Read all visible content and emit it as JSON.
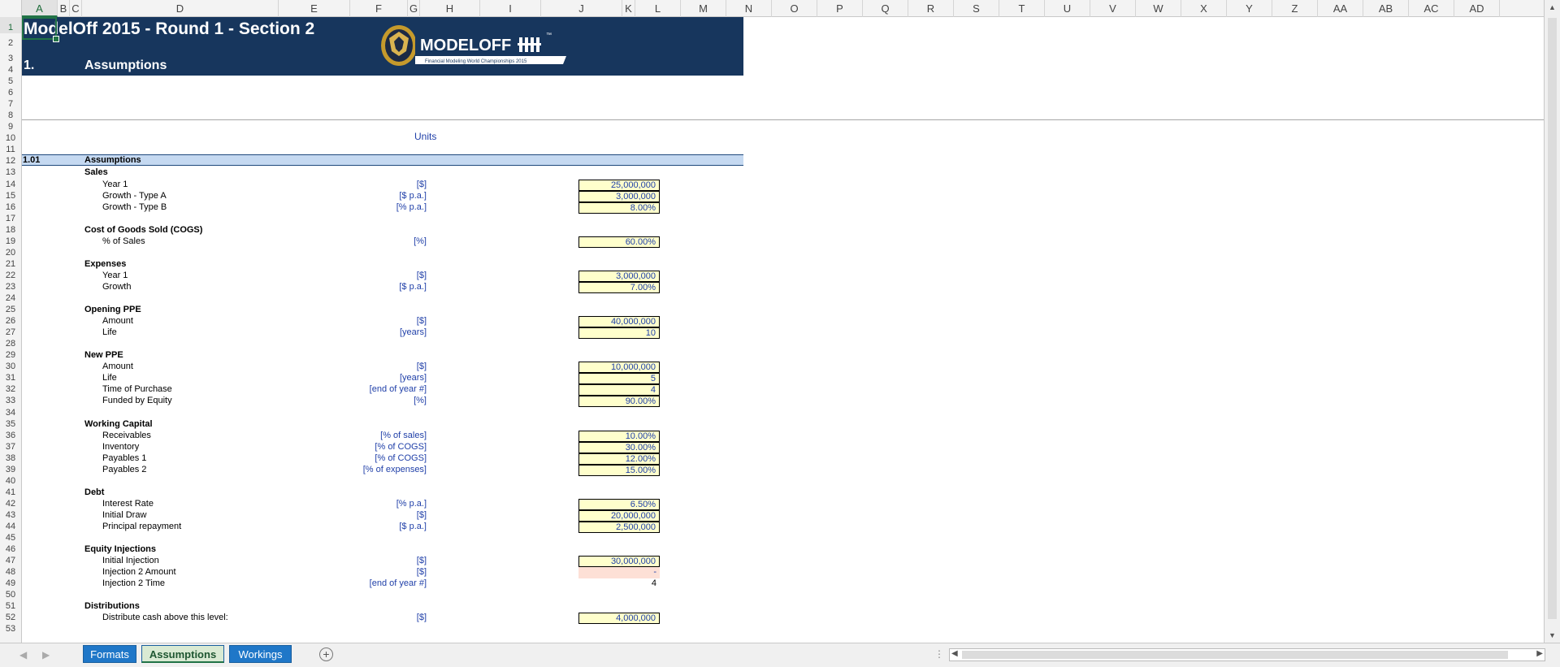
{
  "sheet": {
    "title": "ModelOff 2015 - Round 1 - Section 2",
    "section_number": "1.",
    "section_title": "Assumptions",
    "logo_text": "MODELOFF",
    "logo_tagline": "Financial Modeling World Championships 2015",
    "logo_tm": "™",
    "units_header": "Units",
    "subsection": {
      "number": "1.01",
      "title": "Assumptions"
    }
  },
  "columns": [
    "A",
    "B",
    "C",
    "D",
    "E",
    "F",
    "G",
    "H",
    "I",
    "J",
    "K",
    "L",
    "M",
    "N",
    "O",
    "P",
    "Q",
    "R",
    "S",
    "T",
    "U",
    "V",
    "W",
    "X",
    "Y",
    "Z",
    "AA",
    "AB",
    "AC",
    "AD"
  ],
  "rows": [
    "1",
    "2",
    "3",
    "4",
    "5",
    "6",
    "7",
    "8",
    "9",
    "10",
    "11",
    "12",
    "13",
    "14",
    "15",
    "16",
    "17",
    "18",
    "19",
    "20",
    "21",
    "22",
    "23",
    "24",
    "25",
    "26",
    "27",
    "28",
    "29",
    "30",
    "31",
    "32",
    "33",
    "34",
    "35",
    "36",
    "37",
    "38",
    "39",
    "40",
    "41",
    "42",
    "43",
    "44",
    "45",
    "46",
    "47",
    "48",
    "49",
    "50",
    "51",
    "52",
    "53"
  ],
  "groups": [
    {
      "row": 13,
      "label": "Sales"
    },
    {
      "row": 18,
      "label": "Cost of Goods Sold (COGS)"
    },
    {
      "row": 21,
      "label": "Expenses"
    },
    {
      "row": 25,
      "label": "Opening PPE"
    },
    {
      "row": 29,
      "label": "New PPE"
    },
    {
      "row": 35,
      "label": "Working Capital"
    },
    {
      "row": 41,
      "label": "Debt"
    },
    {
      "row": 46,
      "label": "Equity Injections"
    },
    {
      "row": 51,
      "label": "Distributions"
    }
  ],
  "items": [
    {
      "row": 14,
      "label": "Year 1",
      "unit": "[$]",
      "value": "25,000,000",
      "style": "input"
    },
    {
      "row": 15,
      "label": "Growth - Type A",
      "unit": "[$ p.a.]",
      "value": "3,000,000",
      "style": "input"
    },
    {
      "row": 16,
      "label": "Growth - Type B",
      "unit": "[% p.a.]",
      "value": "8.00%",
      "style": "input"
    },
    {
      "row": 19,
      "label": "% of Sales",
      "unit": "[%]",
      "value": "60.00%",
      "style": "input"
    },
    {
      "row": 22,
      "label": "Year 1",
      "unit": "[$]",
      "value": "3,000,000",
      "style": "input"
    },
    {
      "row": 23,
      "label": "Growth",
      "unit": "[$ p.a.]",
      "value": "7.00%",
      "style": "input"
    },
    {
      "row": 26,
      "label": "Amount",
      "unit": "[$]",
      "value": "40,000,000",
      "style": "input"
    },
    {
      "row": 27,
      "label": "Life",
      "unit": "[years]",
      "value": "10",
      "style": "input"
    },
    {
      "row": 30,
      "label": "Amount",
      "unit": "[$]",
      "value": "10,000,000",
      "style": "input"
    },
    {
      "row": 31,
      "label": "Life",
      "unit": "[years]",
      "value": "5",
      "style": "input"
    },
    {
      "row": 32,
      "label": "Time of Purchase",
      "unit": "[end of year #]",
      "value": "4",
      "style": "input"
    },
    {
      "row": 33,
      "label": "Funded by Equity",
      "unit": "[%]",
      "value": "90.00%",
      "style": "input"
    },
    {
      "row": 36,
      "label": "Receivables",
      "unit": "[% of sales]",
      "value": "10.00%",
      "style": "input"
    },
    {
      "row": 37,
      "label": "Inventory",
      "unit": "[% of COGS]",
      "value": "30.00%",
      "style": "input"
    },
    {
      "row": 38,
      "label": "Payables 1",
      "unit": "[% of COGS]",
      "value": "12.00%",
      "style": "input"
    },
    {
      "row": 39,
      "label": "Payables 2",
      "unit": "[% of expenses]",
      "value": "15.00%",
      "style": "input"
    },
    {
      "row": 42,
      "label": "Interest Rate",
      "unit": "[% p.a.]",
      "value": "6.50%",
      "style": "input"
    },
    {
      "row": 43,
      "label": "Initial Draw",
      "unit": "[$]",
      "value": "20,000,000",
      "style": "input"
    },
    {
      "row": 44,
      "label": "Principal repayment",
      "unit": "[$ p.a.]",
      "value": "2,500,000",
      "style": "input"
    },
    {
      "row": 47,
      "label": "Initial Injection",
      "unit": "[$]",
      "value": "30,000,000",
      "style": "input"
    },
    {
      "row": 48,
      "label": "Injection 2 Amount",
      "unit": "[$]",
      "value": "-",
      "style": "pink"
    },
    {
      "row": 49,
      "label": "Injection 2 Time",
      "unit": "[end of year #]",
      "value": "4",
      "style": "plain"
    },
    {
      "row": 52,
      "label": "Distribute cash above this level:",
      "unit": "[$]",
      "value": "4,000,000",
      "style": "input"
    }
  ],
  "tabs": [
    {
      "label": "Formats",
      "active": false
    },
    {
      "label": "Assumptions",
      "active": true
    },
    {
      "label": "Workings",
      "active": false
    }
  ],
  "icons": {
    "add_sheet": "plus-circle-icon",
    "scroll_left": "triangle-left-icon",
    "scroll_right": "triangle-right-icon"
  },
  "colors": {
    "banner": "#17365d",
    "input_fill": "#ffffcc",
    "unit_text": "#1f3fa8",
    "section_band": "#c5d9f1",
    "tab_blue": "#1f77c8"
  }
}
